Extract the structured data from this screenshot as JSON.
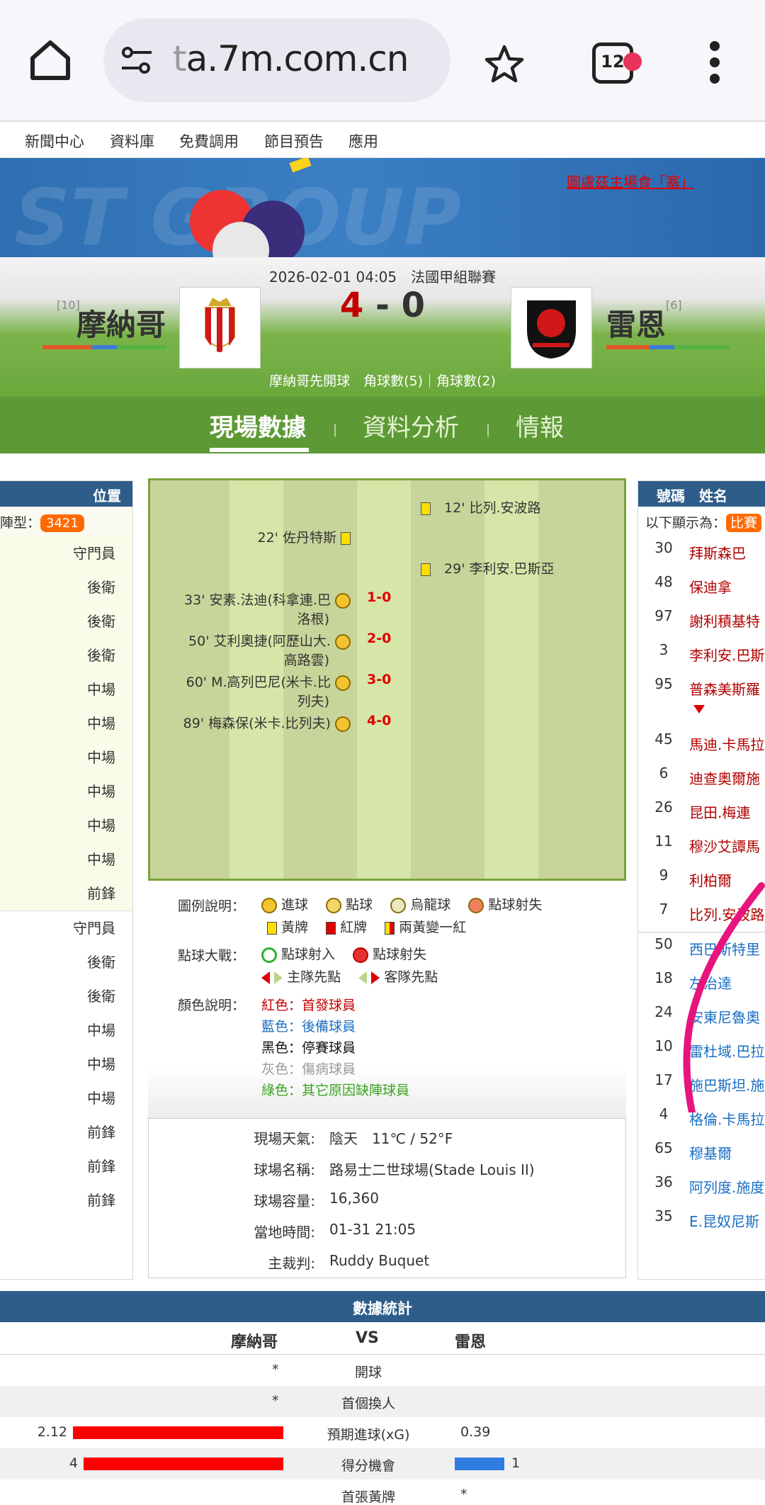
{
  "browser": {
    "url_faded": "t",
    "url_main": "a.7m.com.cn",
    "tab_count": "12"
  },
  "site_nav": [
    "新聞中心",
    "資料庫",
    "免費調用",
    "節目預告",
    "應用"
  ],
  "banner": {
    "link_text": "圖盧茲主場食「塞」"
  },
  "match": {
    "datetime": "2026-02-01 04:05",
    "league": "法國甲組聯賽",
    "home_rank": "[10]",
    "home_name": "摩納哥",
    "away_rank": "[6]",
    "away_name": "雷恩",
    "home_score": "4",
    "score_sep": "-",
    "away_score": "0",
    "kickoff_info": "摩納哥先開球　角球數(5)｜角球數(2)"
  },
  "tabs": [
    "現場數據",
    "資料分析",
    "情報"
  ],
  "home_lineup": {
    "header": "位置",
    "formation_label": "陣型：",
    "formation": "3421",
    "starters": [
      "守門員",
      "後衛",
      "後衛",
      "後衛",
      "中場",
      "中場",
      "中場",
      "中場",
      "中場",
      "中場",
      "前鋒"
    ],
    "subs": [
      "守門員",
      "後衛",
      "後衛",
      "中場",
      "中場",
      "中場",
      "前鋒",
      "前鋒",
      "前鋒"
    ]
  },
  "events": {
    "away_cards": [
      {
        "text": "12' 比列.安波路"
      },
      {
        "text": "29' 李利安.巴斯亞"
      }
    ],
    "home_card": {
      "text": "22' 佐丹特斯"
    },
    "goals": [
      {
        "line1": "33' 安素.法迪(科拿連.巴",
        "line2": "洛根)",
        "score": "1-0"
      },
      {
        "line1": "50' 艾利奧捷(阿歷山大.",
        "line2": "高路雲)",
        "score": "2-0"
      },
      {
        "line1": "60' M.高列巴尼(米卡.比",
        "line2": "列夫)",
        "score": "3-0"
      },
      {
        "line1": "89' 梅森保(米卡.比列夫)",
        "line2": "",
        "score": "4-0"
      }
    ]
  },
  "legend": {
    "title": "圖例說明：",
    "goal": "進球",
    "penalty": "點球",
    "own_goal": "烏龍球",
    "pen_miss": "點球射失",
    "yellow": "黃牌",
    "red": "紅牌",
    "two_yellow": "兩黃變一紅",
    "shootout_title": "點球大戰：",
    "pen_in": "點球射入",
    "pen_out": "點球射失",
    "home_first": "主隊先點",
    "away_first": "客隊先點",
    "color_title": "顏色說明：",
    "c_red": "紅色：首發球員",
    "c_blue": "藍色：後備球員",
    "c_black": "黑色：停賽球員",
    "c_gray": "灰色：傷病球員",
    "c_green": "綠色：其它原因缺陣球員",
    "colors": {
      "red": "#c40000",
      "blue": "#1a6fc4",
      "black": "#111111",
      "gray": "#999999",
      "green": "#3aa320"
    }
  },
  "match_info": [
    {
      "k": "現場天氣:",
      "v": "陰天　11℃ / 52°F"
    },
    {
      "k": "球場名稱:",
      "v": "路易士二世球場(Stade Louis II)"
    },
    {
      "k": "球場容量:",
      "v": "16,360"
    },
    {
      "k": "當地時間:",
      "v": "01-31 21:05"
    },
    {
      "k": "主裁判:",
      "v": "Ruddy Buquet"
    }
  ],
  "away_lineup": {
    "header_no": "號碼",
    "header_name": "姓名",
    "shown_as": "以下顯示為：",
    "shown_badge": "比賽",
    "starters": [
      {
        "no": "30",
        "name": "拜斯森巴"
      },
      {
        "no": "48",
        "name": "保迪拿"
      },
      {
        "no": "97",
        "name": "謝利積基特"
      },
      {
        "no": "3",
        "name": "李利安.巴斯"
      },
      {
        "no": "95",
        "name": "普森美斯羅"
      },
      {
        "no": "45",
        "name": "馬迪.卡馬拉"
      },
      {
        "no": "6",
        "name": "迪查奧爾施"
      },
      {
        "no": "26",
        "name": "昆田.梅連"
      },
      {
        "no": "11",
        "name": "穆沙艾譚馬"
      },
      {
        "no": "9",
        "name": "利柏爾"
      },
      {
        "no": "7",
        "name": "比列.安波路"
      }
    ],
    "subs": [
      {
        "no": "50",
        "name": "西巴斯特里"
      },
      {
        "no": "18",
        "name": "左治達"
      },
      {
        "no": "24",
        "name": "安東尼魯奧"
      },
      {
        "no": "10",
        "name": "雷杜域.巴拉"
      },
      {
        "no": "17",
        "name": "施巴斯坦.施"
      },
      {
        "no": "4",
        "name": "格倫.卡馬拉"
      },
      {
        "no": "65",
        "name": "穆基爾"
      },
      {
        "no": "36",
        "name": "阿列度.施度"
      },
      {
        "no": "35",
        "name": "E.昆奴尼斯"
      }
    ]
  },
  "stats": {
    "title": "數據統計",
    "home": "摩納哥",
    "vs": "VS",
    "away": "雷恩",
    "rows": [
      {
        "label": "開球",
        "home": "*",
        "away": ""
      },
      {
        "label": "首個換人",
        "home": "*",
        "away": ""
      },
      {
        "label": "預期進球(xG)",
        "home": "2.12",
        "away": "0.39",
        "home_frac": 0.845,
        "away_frac": 0
      },
      {
        "label": "得分機會",
        "home": "4",
        "away": "1",
        "home_frac": 0.8,
        "away_frac": 0.2
      },
      {
        "label": "首張黃牌",
        "home": "",
        "away": "*"
      }
    ]
  }
}
